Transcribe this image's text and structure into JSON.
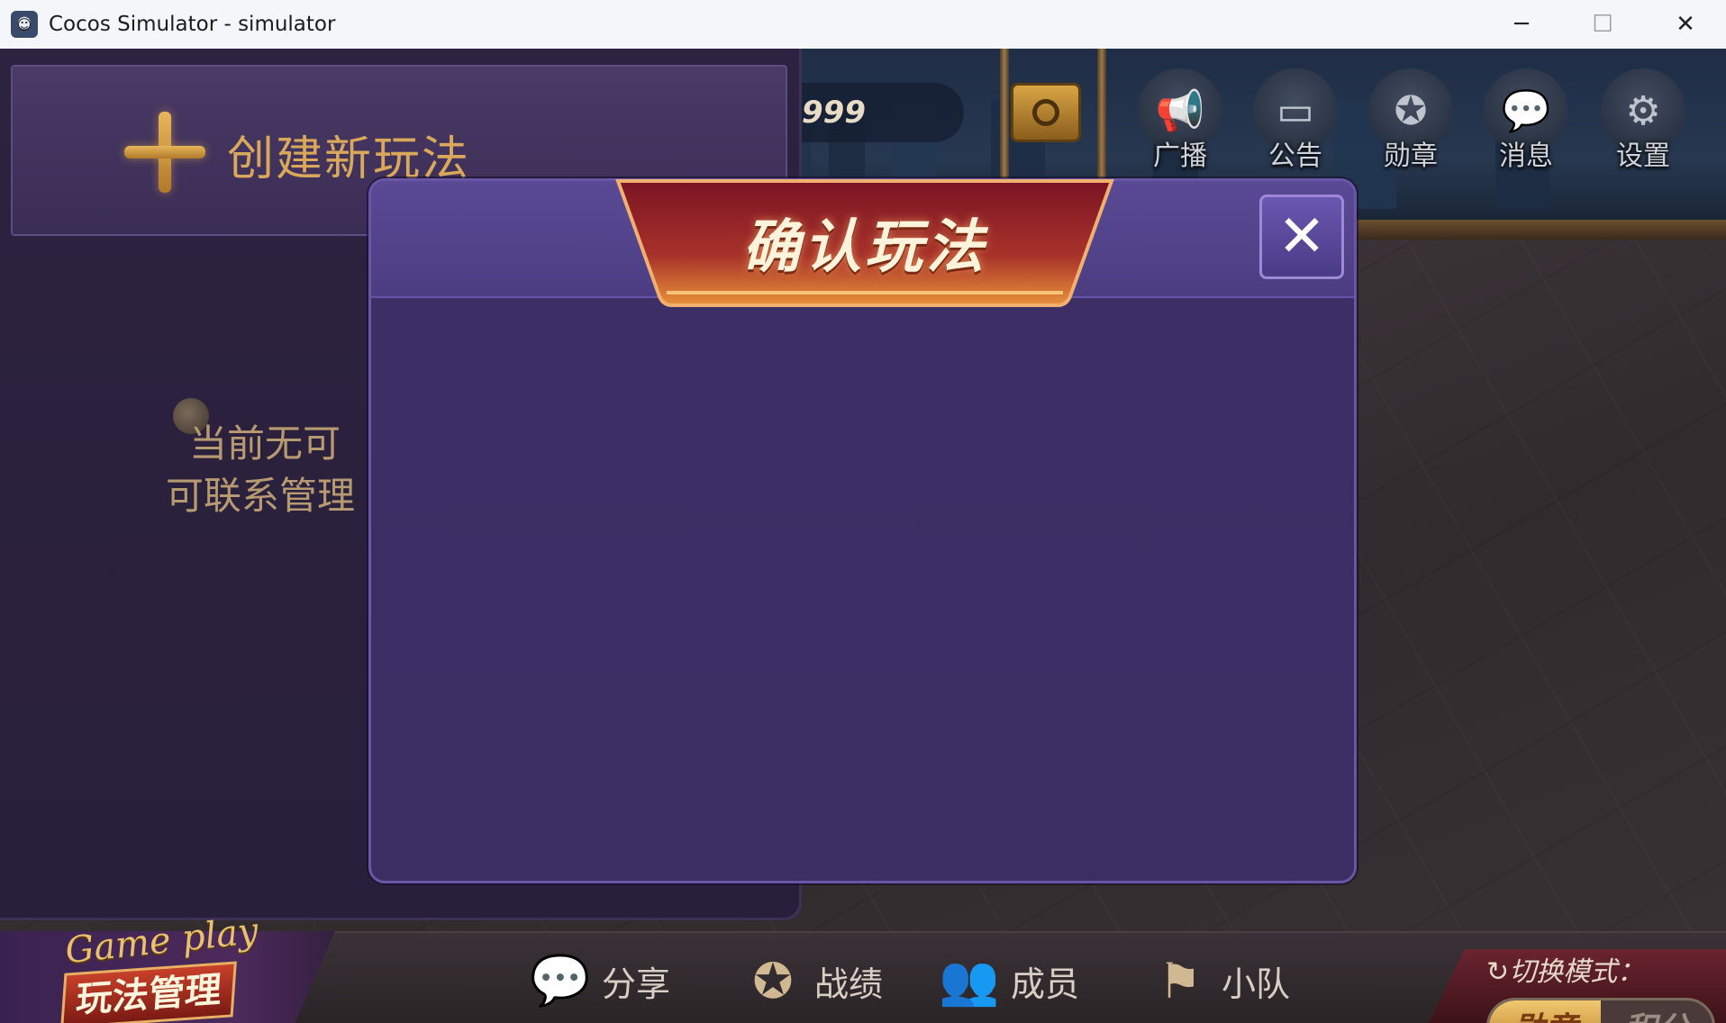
{
  "window": {
    "title": "Cocos Simulator - simulator",
    "minimize_glyph": "─",
    "maximize_glyph": "☐",
    "close_glyph": "✕"
  },
  "header": {
    "coin_value": "999",
    "buttons": [
      {
        "label": "广播",
        "icon": "megaphone-icon",
        "glyph": "📢"
      },
      {
        "label": "公告",
        "icon": "notice-board-icon",
        "glyph": "▭"
      },
      {
        "label": "勋章",
        "icon": "medal-icon",
        "glyph": "✪"
      },
      {
        "label": "消息",
        "icon": "chat-bubble-icon",
        "glyph": "💬"
      },
      {
        "label": "设置",
        "icon": "gear-icon",
        "glyph": "⚙"
      }
    ]
  },
  "left_panel": {
    "create_label": "创建新玩法",
    "empty_line1": "当前无可",
    "empty_line2": "可联系管理"
  },
  "modal": {
    "title": "确认玩法",
    "close_glyph": "✕"
  },
  "bottom_bar": {
    "badge_script": "Game play",
    "badge_title": "玩法管理",
    "tabs": [
      {
        "label": "分享",
        "icon": "wechat-icon",
        "glyph": "💬"
      },
      {
        "label": "战绩",
        "icon": "trophy-medal-icon",
        "glyph": "✪"
      },
      {
        "label": "成员",
        "icon": "members-icon",
        "glyph": "👥"
      },
      {
        "label": "小队",
        "icon": "flag-icon",
        "glyph": "⚑"
      }
    ],
    "mode_title": "↻切换模式：",
    "mode_options": [
      "勋章",
      "积分"
    ],
    "mode_selected": "勋章"
  }
}
